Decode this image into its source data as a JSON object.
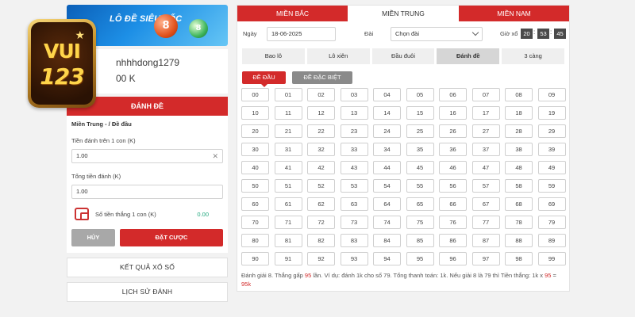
{
  "banner": {
    "title": "LÔ ĐỀ SIÊU TỐC",
    "red_ball": "8",
    "green_ball": "8"
  },
  "logo": {
    "text_top": "VUI",
    "text_bottom": "123"
  },
  "profile": {
    "username": "nhhhdong1279",
    "balance": "00 K"
  },
  "left_tab": "ĐÁNH ĐỀ",
  "form": {
    "breadcrumb": "Miền Trung - / Đề đầu",
    "amount_label": "Tiền đánh trên 1 con (K)",
    "amount_value": "1.00",
    "total_label": "Tổng tiền đánh (K)",
    "total_value": "1.00",
    "win_label": "Số tiền thắng 1 con (K)",
    "win_value": "0.00",
    "cancel_label": "HỦY",
    "bet_label": "ĐẶT CƯỢC"
  },
  "side_links": [
    "KẾT QUẢ XỔ SỐ",
    "LỊCH SỬ ĐÁNH"
  ],
  "regions": [
    "MIỀN BẮC",
    "MIỀN TRUNG",
    "MIỀN NAM"
  ],
  "filters": {
    "date_label": "Ngày",
    "date_value": "18-06-2025",
    "station_label": "Đài",
    "station_value": "Chọn đài",
    "time_label": "Giờ xổ",
    "hh": "20",
    "mm": "53",
    "ss": "45"
  },
  "bet_types": [
    "Bao lô",
    "Lô xiên",
    "Đầu đuôi",
    "Đánh đề",
    "3 càng"
  ],
  "sub_types": [
    "ĐỀ ĐẦU",
    "ĐỀ ĐẶC BIỆT"
  ],
  "numbers": [
    "00",
    "01",
    "02",
    "03",
    "04",
    "05",
    "06",
    "07",
    "08",
    "09",
    "10",
    "11",
    "12",
    "13",
    "14",
    "15",
    "16",
    "17",
    "18",
    "19",
    "20",
    "21",
    "22",
    "23",
    "24",
    "25",
    "26",
    "27",
    "28",
    "29",
    "30",
    "31",
    "32",
    "33",
    "34",
    "35",
    "36",
    "37",
    "38",
    "39",
    "40",
    "41",
    "42",
    "43",
    "44",
    "45",
    "46",
    "47",
    "48",
    "49",
    "50",
    "51",
    "52",
    "53",
    "54",
    "55",
    "56",
    "57",
    "58",
    "59",
    "60",
    "61",
    "62",
    "63",
    "64",
    "65",
    "66",
    "67",
    "68",
    "69",
    "70",
    "71",
    "72",
    "73",
    "74",
    "75",
    "76",
    "77",
    "78",
    "79",
    "80",
    "81",
    "82",
    "83",
    "84",
    "85",
    "86",
    "87",
    "88",
    "89",
    "90",
    "91",
    "92",
    "93",
    "94",
    "95",
    "96",
    "97",
    "98",
    "99"
  ],
  "note": {
    "p1": "Đánh giải 8. Thắng gấp ",
    "h1": "95",
    "p2": " lần. Ví dụ: đánh 1k cho số 79. Tổng thanh toán: 1k. Nếu giải 8 là 79 thì Tiền thắng: 1k x ",
    "h2": "95",
    "p3": " = ",
    "h3": "95k"
  },
  "colors": {
    "accent": "#d32a2a",
    "win_value": "#21a87e"
  }
}
